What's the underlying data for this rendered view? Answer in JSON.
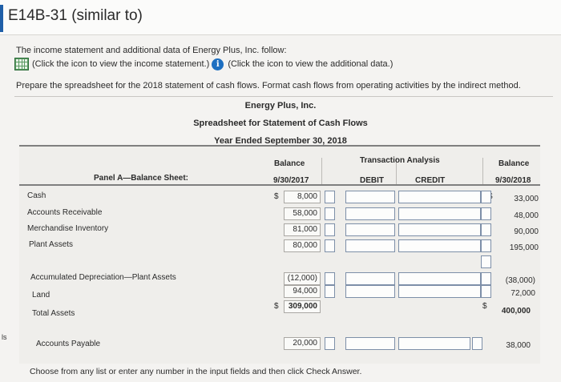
{
  "title": "E14B-31 (similar to)",
  "intro": "The income statement and additional data of Energy Plus, Inc. follow:",
  "links": {
    "income_statement": "(Click the icon to view the income statement.)",
    "additional_data": "(Click the icon to view the additional data.)"
  },
  "instruction": "Prepare the spreadsheet for the 2018 statement of cash flows. Format cash flows from operating activities by the indirect method.",
  "company": "Energy Plus, Inc.",
  "statement_title": "Spreadsheet for Statement of Cash Flows",
  "period": "Year Ended September 30, 2018",
  "columns": {
    "balance_label": "Balance",
    "balance_2017": "9/30/2017",
    "transaction_analysis": "Transaction Analysis",
    "debit": "DEBIT",
    "credit": "CREDIT",
    "balance_2018": "9/30/2018"
  },
  "panel_label": "Panel A—Balance Sheet:",
  "currency_symbol": "$",
  "rows": [
    {
      "name": "Cash",
      "begin": "8,000",
      "end": "33,000"
    },
    {
      "name": "Accounts Receivable",
      "begin": "58,000",
      "end": "48,000"
    },
    {
      "name": "Merchandise Inventory",
      "begin": "81,000",
      "end": "90,000"
    },
    {
      "name": "Plant Assets",
      "begin": "80,000",
      "end": "195,000"
    },
    {
      "name": "Accumulated Depreciation—Plant Assets",
      "begin": "(12,000)",
      "end": "(38,000)"
    },
    {
      "name": "Land",
      "begin": "94,000",
      "end": "72,000"
    },
    {
      "name": "Total Assets",
      "begin": "309,000",
      "end": "400,000"
    },
    {
      "name": "Accounts Payable",
      "begin": "20,000",
      "end": "38,000"
    }
  ],
  "side_mark": "ls",
  "footer": "Choose from any list or enter any number in the input fields and then click Check Answer."
}
